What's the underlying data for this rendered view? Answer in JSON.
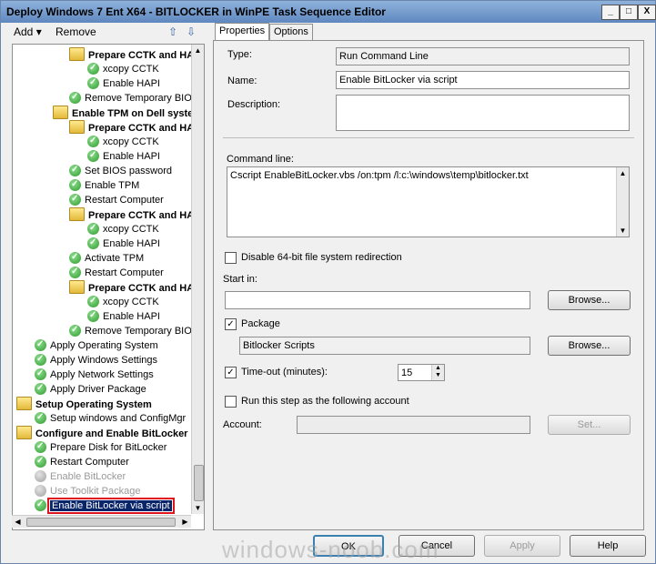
{
  "window": {
    "title": "Deploy Windows 7 Ent X64 - BITLOCKER in WinPE Task Sequence Editor",
    "controls": {
      "minimize": "_",
      "maximize": "□",
      "close": "X"
    }
  },
  "toolbar": {
    "add": "Add",
    "add_arrow": "▾",
    "remove": "Remove"
  },
  "tree": {
    "items": [
      {
        "label": "Prepare CCTK and HAPI",
        "kind": "group",
        "indent": 3
      },
      {
        "label": "xcopy CCTK",
        "kind": "step",
        "indent": 4
      },
      {
        "label": "Enable HAPI",
        "kind": "step",
        "indent": 4
      },
      {
        "label": "Remove Temporary BIOS",
        "kind": "step",
        "indent": 3
      },
      {
        "label": "Enable TPM on Dell system",
        "kind": "group",
        "indent": 2
      },
      {
        "label": "Prepare CCTK and HAPI",
        "kind": "group",
        "indent": 3
      },
      {
        "label": "xcopy CCTK",
        "kind": "step",
        "indent": 4
      },
      {
        "label": "Enable HAPI",
        "kind": "step",
        "indent": 4
      },
      {
        "label": "Set BIOS password",
        "kind": "step",
        "indent": 3
      },
      {
        "label": "Enable TPM",
        "kind": "step",
        "indent": 3
      },
      {
        "label": "Restart Computer",
        "kind": "step",
        "indent": 3
      },
      {
        "label": "Prepare CCTK and HAPI",
        "kind": "group",
        "indent": 3
      },
      {
        "label": "xcopy CCTK",
        "kind": "step",
        "indent": 4
      },
      {
        "label": "Enable HAPI",
        "kind": "step",
        "indent": 4
      },
      {
        "label": "Activate TPM",
        "kind": "step",
        "indent": 3
      },
      {
        "label": "Restart Computer",
        "kind": "step",
        "indent": 3
      },
      {
        "label": "Prepare CCTK and HAPI",
        "kind": "group",
        "indent": 3
      },
      {
        "label": "xcopy CCTK",
        "kind": "step",
        "indent": 4
      },
      {
        "label": "Enable HAPI",
        "kind": "step",
        "indent": 4
      },
      {
        "label": "Remove Temporary BIOS",
        "kind": "step",
        "indent": 3
      },
      {
        "label": "Apply Operating System",
        "kind": "step",
        "indent": 1
      },
      {
        "label": "Apply Windows Settings",
        "kind": "step",
        "indent": 1
      },
      {
        "label": "Apply Network Settings",
        "kind": "step",
        "indent": 1
      },
      {
        "label": "Apply Driver Package",
        "kind": "step",
        "indent": 1
      },
      {
        "label": "Setup Operating System",
        "kind": "group",
        "indent": 0
      },
      {
        "label": "Setup windows and ConfigMgr",
        "kind": "step",
        "indent": 1
      },
      {
        "label": "Configure and Enable BitLocker",
        "kind": "group",
        "indent": 0
      },
      {
        "label": "Prepare Disk for BitLocker",
        "kind": "step",
        "indent": 1
      },
      {
        "label": "Restart Computer",
        "kind": "step",
        "indent": 1
      },
      {
        "label": "Enable BitLocker",
        "kind": "disabled",
        "indent": 1
      },
      {
        "label": "Use Toolkit Package",
        "kind": "disabled",
        "indent": 1
      },
      {
        "label": "Enable BitLocker via script",
        "kind": "selected",
        "indent": 1
      }
    ]
  },
  "tabs": {
    "properties": "Properties",
    "options": "Options"
  },
  "properties": {
    "type_label": "Type:",
    "type_value": "Run Command Line",
    "name_label": "Name:",
    "name_value": "Enable BitLocker via script",
    "description_label": "Description:",
    "description_value": "",
    "command_line_label": "Command line:",
    "command_line_value": "Cscript EnableBitLocker.vbs /on:tpm /l:c:\\windows\\temp\\bitlocker.txt",
    "disable_redirect_label": "Disable 64-bit file system redirection",
    "disable_redirect_checked": false,
    "start_in_label": "Start in:",
    "start_in_value": "",
    "browse_label": "Browse...",
    "package_label": "Package",
    "package_checked": true,
    "package_value": "Bitlocker Scripts",
    "package_browse_label": "Browse...",
    "timeout_label": "Time-out (minutes):",
    "timeout_checked": true,
    "timeout_value": "15",
    "run_as_label": "Run this step as the following account",
    "run_as_checked": false,
    "account_label": "Account:",
    "account_value": "",
    "set_label": "Set..."
  },
  "footer": {
    "ok": "OK",
    "cancel": "Cancel",
    "apply": "Apply",
    "help": "Help"
  },
  "watermark": "windows-noob.com"
}
